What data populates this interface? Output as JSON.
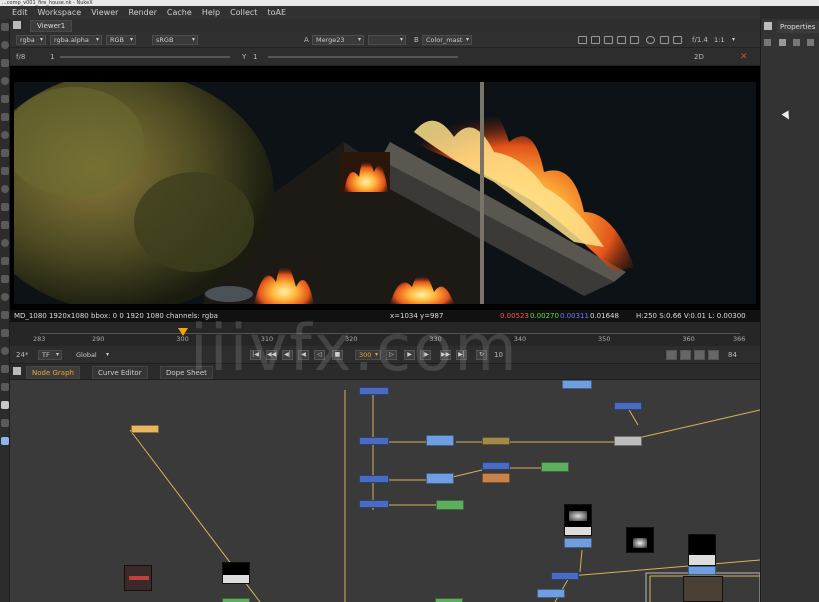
{
  "title_bar": {
    "text": "...comp_v001_fire_house.nk - NukeX"
  },
  "menu": [
    "Edit",
    "Workspace",
    "Viewer",
    "Render",
    "Cache",
    "Help",
    "Collect",
    "toAE"
  ],
  "viewer": {
    "tab": "Viewer1",
    "channels": "rgba",
    "channel_alpha": "rgba.alpha",
    "display": "RGB",
    "lut": "sRGB",
    "input_a_label": "A",
    "input_a": "Merge23",
    "input_b_label": "B",
    "input_b": "Color_mast",
    "zoom_label": "f/8",
    "gain_value": "1",
    "gamma_label": "Y",
    "gamma_value": "1",
    "frame_range": "f/1.4",
    "scale": "1:1",
    "view_mode": "2D"
  },
  "info_bar": {
    "format": "MD_1080 1920x1080  bbox: 0 0 1920 1080 channels: rgba",
    "coords": "x=1034 y=987",
    "r": "0.00523",
    "g": "0.00270",
    "b": "0.00311",
    "a": "0.01648",
    "hsv": "H:250 S:0.66 V:0.01  L: 0.00300"
  },
  "timeline": {
    "ticks": [
      "283",
      "290",
      "300",
      "310",
      "320",
      "330",
      "340",
      "350",
      "360",
      "366"
    ],
    "start": "283",
    "end": "366",
    "current_frame": 300,
    "frame_field": "300",
    "fps": "24*",
    "mode": "TF",
    "scope": "Global",
    "increment": "10",
    "end_field": "84"
  },
  "node_graph_tabs": [
    {
      "label": "Node Graph",
      "active": true
    },
    {
      "label": "Curve Editor",
      "active": false
    },
    {
      "label": "Dope Sheet",
      "active": false
    }
  ],
  "properties": {
    "tab": "Properties"
  },
  "watermark": "iiivfx.com",
  "colors": {
    "accent": "#f0a030",
    "node_blue": "#4a6bc2",
    "node_lightblue": "#6f9fe0",
    "node_green": "#5fae5f",
    "node_orange": "#c9834a",
    "node_olive": "#a08a4a",
    "node_gray": "#bdbdbd",
    "node_yellow": "#e8b661"
  }
}
